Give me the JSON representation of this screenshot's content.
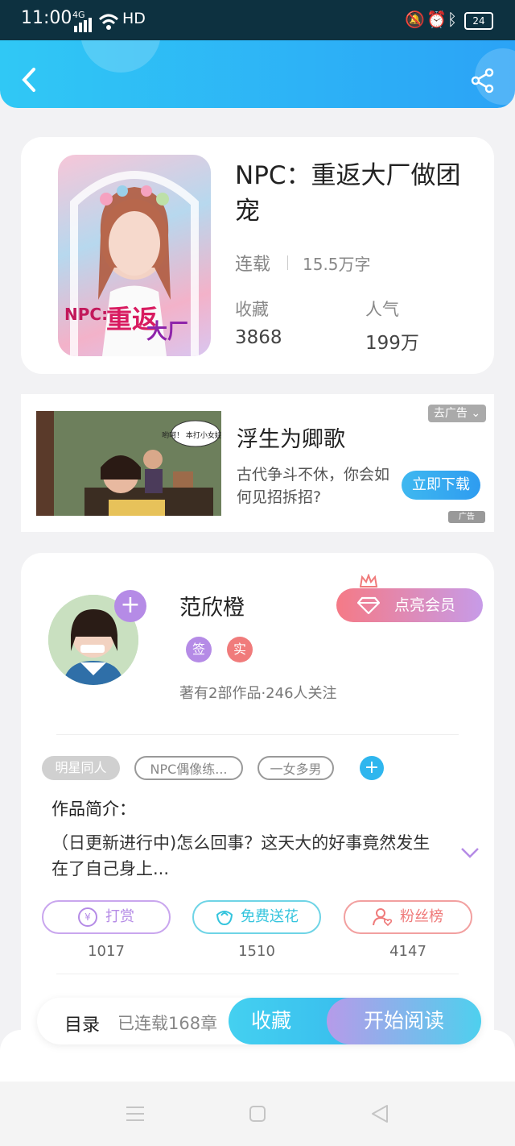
{
  "status_bar": {
    "time": "11:00",
    "network": "4G",
    "hd": "HD",
    "battery": "24"
  },
  "header": {
    "back_icon": "back-arrow-icon",
    "share_icon": "share-icon",
    "accent": "#2ba3f6"
  },
  "book": {
    "title": "NPC：重返大厂做团宠",
    "status": "连载",
    "word_count": "15.5万字",
    "favorites_label": "收藏",
    "favorites_value": "3868",
    "popularity_label": "人气",
    "popularity_value": "199万"
  },
  "ad": {
    "close_label": "去广告",
    "title": "浮生为卿歌",
    "desc": "古代争斗不休，你会如何见招拆招?",
    "download_label": "立即下载",
    "badge": "广告",
    "bubble_text": "哟呵！ 本打小女娃子"
  },
  "author": {
    "name": "范欣橙",
    "badge_sign": "签",
    "badge_real": "实",
    "stats": "著有2部作品·246人关注",
    "vip_label": "点亮会员"
  },
  "tags": [
    "明星同人",
    "NPC偶像练...",
    "一女多男"
  ],
  "intro": {
    "heading": "作品简介：",
    "text": "（日更新进行中)怎么回事？这天大的好事竟然发生在了自己身上..."
  },
  "actions": [
    {
      "label": "打赏",
      "count": "1017",
      "color": "#b58be6"
    },
    {
      "label": "免费送花",
      "count": "1510",
      "color": "#34c4dd"
    },
    {
      "label": "粉丝榜",
      "count": "4147",
      "color": "#ef7a7a"
    }
  ],
  "bottom": {
    "catalog_label": "目录",
    "chapters": "已连载168章",
    "collect_label": "收藏",
    "read_label": "开始阅读"
  }
}
